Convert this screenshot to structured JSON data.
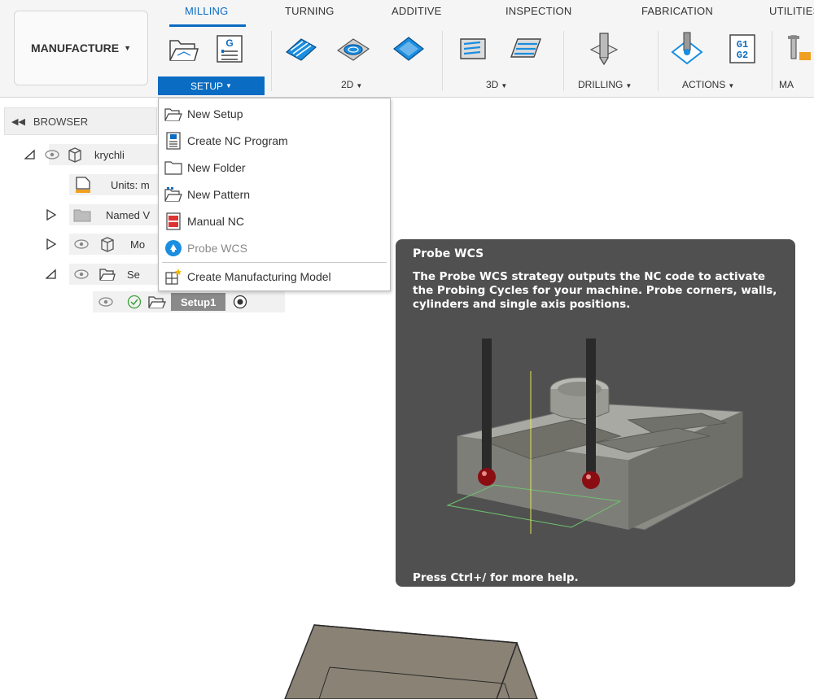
{
  "ribbon": {
    "tabs": [
      {
        "label": "MILLING",
        "active": true
      },
      {
        "label": "TURNING",
        "active": false
      },
      {
        "label": "ADDITIVE",
        "active": false
      },
      {
        "label": "INSPECTION",
        "active": false
      },
      {
        "label": "FABRICATION",
        "active": false
      },
      {
        "label": "UTILITIES",
        "active": false
      }
    ],
    "workspace_label": "MANUFACTURE",
    "groups": {
      "setup": "SETUP",
      "two_d": "2D",
      "three_d": "3D",
      "drilling": "DRILLING",
      "actions": "ACTIONS",
      "manage": "MA"
    },
    "accent_color": "#0a6cc2"
  },
  "browser": {
    "header": "BROWSER",
    "items": [
      {
        "label": "krychli",
        "icon": "component-icon"
      },
      {
        "label": "Units: m",
        "icon": "document-units-icon"
      },
      {
        "label": "Named V",
        "icon": "folder-icon"
      },
      {
        "label": "Mo",
        "icon": "component-icon"
      },
      {
        "label": "Se",
        "icon": "setup-folder-icon"
      },
      {
        "label": "Setup1",
        "icon": "setup-folder-icon"
      }
    ]
  },
  "setup_menu": {
    "items": [
      {
        "label": "New Setup",
        "icon": "new-setup-icon",
        "enabled": true
      },
      {
        "label": "Create NC Program",
        "icon": "nc-program-icon",
        "enabled": true
      },
      {
        "label": "New Folder",
        "icon": "folder-icon",
        "enabled": true
      },
      {
        "label": "New Pattern",
        "icon": "pattern-icon",
        "enabled": true
      },
      {
        "label": "Manual NC",
        "icon": "manual-nc-icon",
        "enabled": true
      },
      {
        "label": "Probe WCS",
        "icon": "probe-wcs-icon",
        "enabled": false
      },
      {
        "label": "Create Manufacturing Model",
        "icon": "manufacturing-model-icon",
        "enabled": true
      }
    ]
  },
  "tooltip": {
    "title": "Probe WCS",
    "description": "The Probe WCS strategy outputs the NC code to activate the Probing Cycles for your machine. Probe corners, walls, cylinders and single axis positions.",
    "help": "Press Ctrl+/ for more help."
  },
  "actions_icon_text": {
    "line1": "G1",
    "line2": "G2"
  },
  "nc_icon_text": "G"
}
